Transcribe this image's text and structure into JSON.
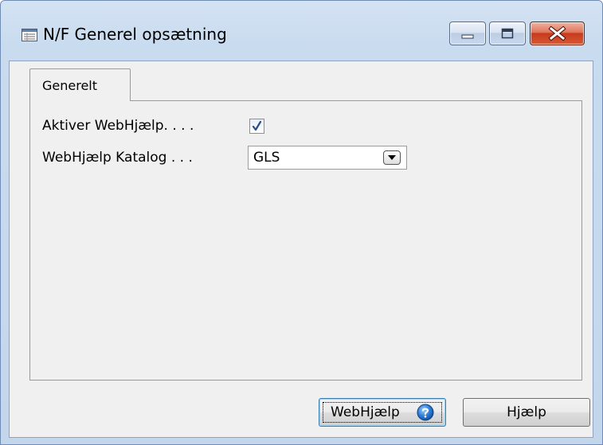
{
  "window": {
    "title": "N/F Generel opsætning",
    "icon": "form-icon"
  },
  "caption_buttons": {
    "minimize_icon": "minimize-icon",
    "maximize_icon": "maximize-icon",
    "close_icon": "close-icon"
  },
  "tabs": [
    {
      "label": "Generelt",
      "selected": true
    }
  ],
  "fields": {
    "aktiver_webhjaelp": {
      "label": "Aktiver WebHjælp. . . .",
      "checked": true
    },
    "webhjaelp_katalog": {
      "label": "WebHjælp Katalog . . .",
      "value": "GLS",
      "dropdown_icon": "dropdown-arrow-icon"
    }
  },
  "buttons": {
    "webhjaelp": {
      "label": "WebHjælp",
      "icon": "help-icon"
    },
    "hjaelp": {
      "label": "Hjælp"
    }
  },
  "colors": {
    "titlebar": "#c9dbef",
    "client_bg": "#f0f0f0",
    "close_button": "#c8391d",
    "focus_border": "#3c7fb1"
  }
}
